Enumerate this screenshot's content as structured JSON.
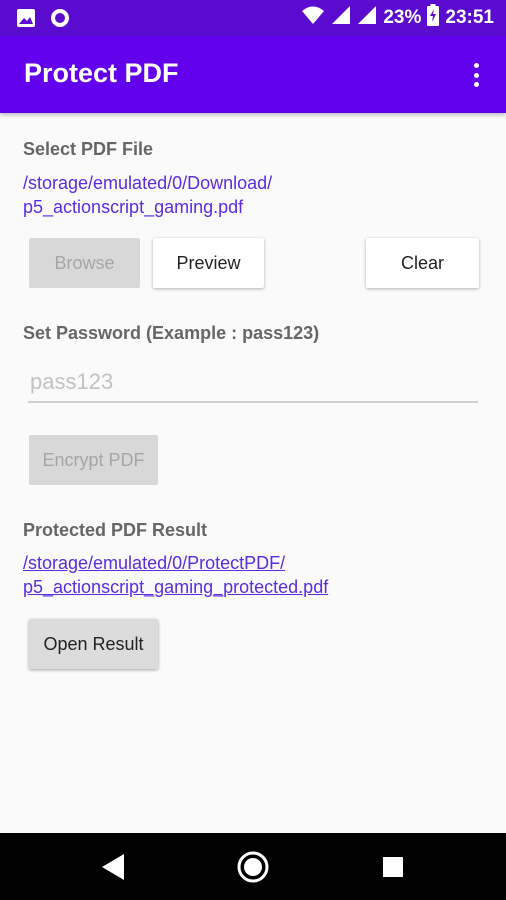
{
  "status_bar": {
    "battery_percent": "23%",
    "time": "23:51",
    "icons": [
      "image-icon",
      "circle-status-icon",
      "wifi-icon",
      "signal-icon",
      "signal-icon",
      "battery-charging-icon"
    ]
  },
  "app_bar": {
    "title": "Protect PDF",
    "menu_icon": "overflow-menu-icon"
  },
  "select_section": {
    "label": "Select PDF File",
    "path_line1": "/storage/emulated/0/Download/",
    "path_line2": "p5_actionscript_gaming.pdf"
  },
  "buttons": {
    "browse": "Browse",
    "preview": "Preview",
    "clear": "Clear",
    "encrypt": "Encrypt PDF",
    "open_result": "Open Result"
  },
  "password_section": {
    "label": "Set Password (Example : pass123)",
    "value": "",
    "placeholder": "pass123"
  },
  "result_section": {
    "label": "Protected PDF Result",
    "path_line1": "/storage/emulated/0/ProtectPDF/",
    "path_line2": "p5_actionscript_gaming_protected.pdf"
  },
  "nav_bar": {
    "icons": [
      "back-icon",
      "home-icon",
      "recents-icon"
    ]
  },
  "colors": {
    "primary": "#6200ee",
    "status_bar": "#5a0bcf",
    "link": "#5a2be0"
  }
}
